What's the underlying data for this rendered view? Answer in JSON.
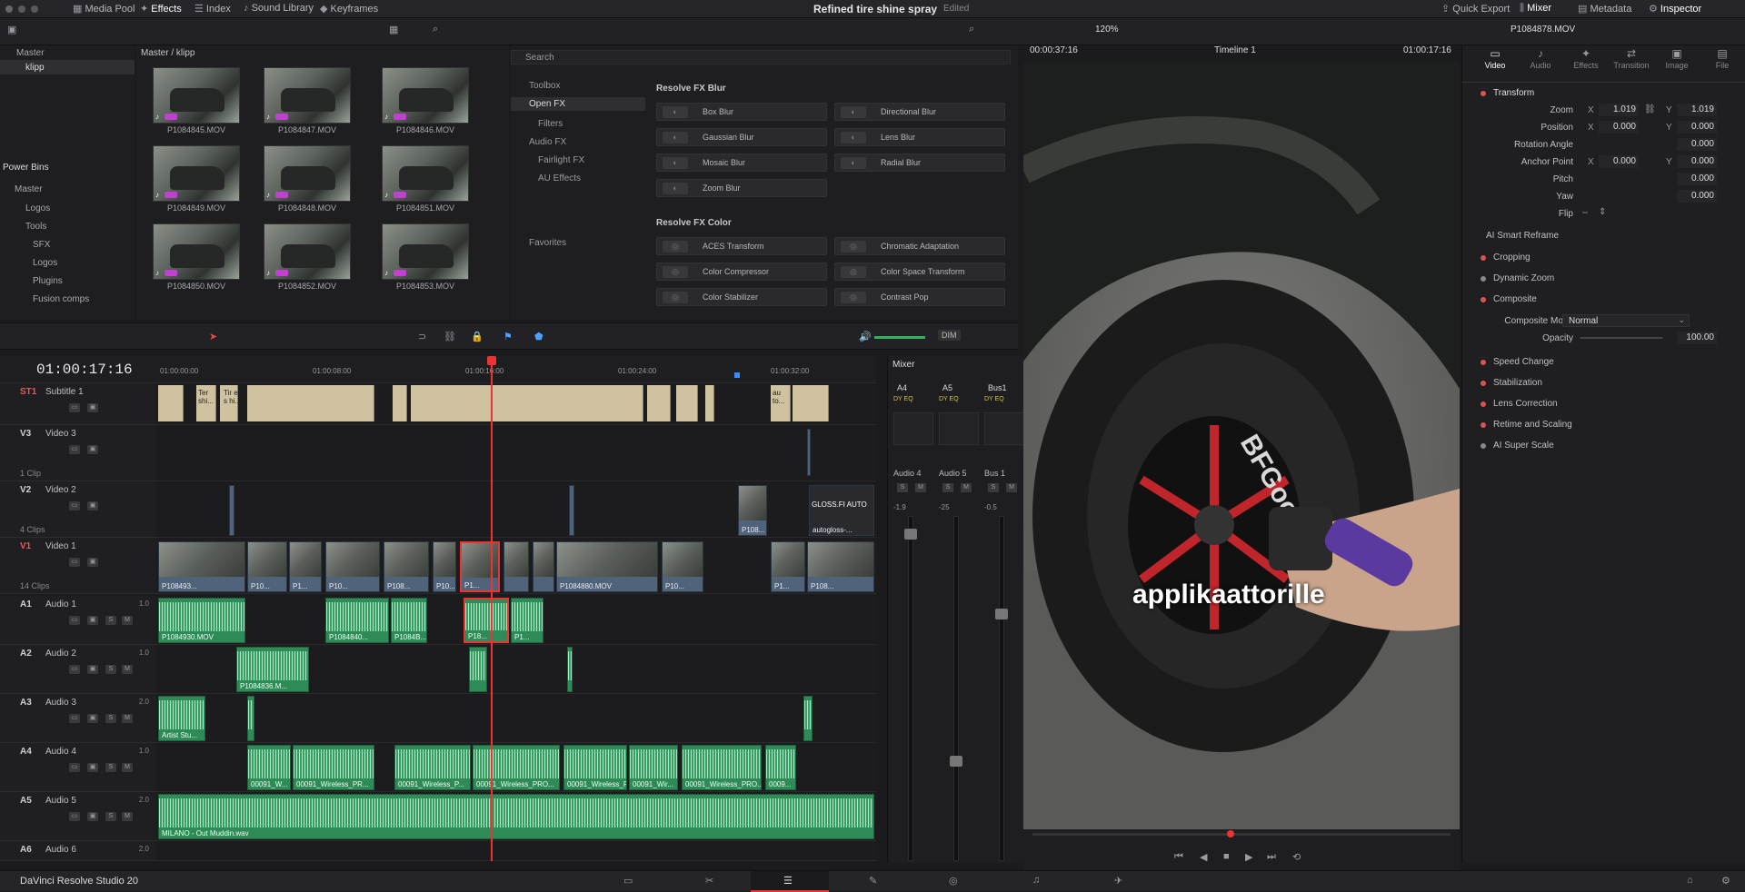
{
  "topbar": {
    "media_pool": "Media Pool",
    "effects": "Effects",
    "index": "Index",
    "sound_library": "Sound Library",
    "keyframes": "Keyframes",
    "project_title": "Refined tire shine spray",
    "edited": "Edited",
    "quick_export": "Quick Export",
    "mixer": "Mixer",
    "metadata": "Metadata",
    "inspector": "Inspector"
  },
  "viewer_bar": {
    "zoom": "120%",
    "timecode_left": "00:00:37:16",
    "timeline_name": "Timeline 1",
    "timecode_right": "01:00:17:16",
    "clip_name": "P1084878.MOV"
  },
  "bins": {
    "master": "Master",
    "klipp": "klipp",
    "path": "Master / klipp",
    "power_bins": "Power Bins",
    "pb_master": "Master",
    "logos": "Logos",
    "tools": "Tools",
    "sfx": "SFX",
    "logos2": "Logos",
    "plugins": "Plugins",
    "fusion_comps": "Fusion comps"
  },
  "clips": [
    "P1084845.MOV",
    "P1084847.MOV",
    "P1084846.MOV",
    "P1084849.MOV",
    "P1084848.MOV",
    "P1084851.MOV",
    "P1084850.MOV",
    "P1084852.MOV",
    "P1084853.MOV"
  ],
  "fx": {
    "search_placeholder": "Search",
    "toolbox": "Toolbox",
    "open_fx": "Open FX",
    "filters": "Filters",
    "audio_fx": "Audio FX",
    "fairlight_fx": "Fairlight FX",
    "au_effects": "AU Effects",
    "favorites": "Favorites",
    "blur_section": "Resolve FX Blur",
    "blur_items": [
      "Box Blur",
      "Directional Blur",
      "Gaussian Blur",
      "Lens Blur",
      "Mosaic Blur",
      "Radial Blur",
      "Zoom Blur"
    ],
    "color_section": "Resolve FX Color",
    "color_items": [
      "ACES Transform",
      "Chromatic Adaptation",
      "Color Compressor",
      "Color Space Transform",
      "Color Stabilizer",
      "Contrast Pop"
    ]
  },
  "timeline": {
    "timecode": "01:00:17:16",
    "ruler": [
      "01:00:00:00",
      "01:00:08:00",
      "01:00:16:00",
      "01:00:24:00",
      "01:00:32:00"
    ],
    "dim": "DIM",
    "tracks": {
      "st1": {
        "id": "ST1",
        "name": "Subtitle 1"
      },
      "v3": {
        "id": "V3",
        "name": "Video 3",
        "count": "1 Clip"
      },
      "v2": {
        "id": "V2",
        "name": "Video 2",
        "count": "4 Clips"
      },
      "v1": {
        "id": "V1",
        "name": "Video 1",
        "count": "14 Clips"
      },
      "a1": {
        "id": "A1",
        "name": "Audio 1",
        "vol": "1.0"
      },
      "a2": {
        "id": "A2",
        "name": "Audio 2",
        "vol": "1.0"
      },
      "a3": {
        "id": "A3",
        "name": "Audio 3",
        "vol": "2.0"
      },
      "a4": {
        "id": "A4",
        "name": "Audio 4",
        "vol": "1.0"
      },
      "a5": {
        "id": "A5",
        "name": "Audio 5",
        "vol": "2.0"
      },
      "a6": {
        "id": "A6",
        "name": "Audio 6",
        "vol": "2.0"
      }
    },
    "subtitle_texts": [
      "Ter shi...",
      "Tir e s hi...",
      "au to..."
    ],
    "v2_labels": [
      "P108...",
      "GLOSS.FI AUTO",
      "autogloss-..."
    ],
    "v1_labels": [
      "P108493...",
      "P10...",
      "P1...",
      "P10...",
      "P108...",
      "P10...",
      "P1...",
      "P1084880.MOV",
      "P10...",
      "P1...",
      "P108..."
    ],
    "a1_labels": [
      "P1084930.MOV",
      "P1084840...",
      "P1084B...",
      "P18...",
      "P1..."
    ],
    "a2_labels": [
      "P1084836.M..."
    ],
    "a3_labels": [
      "Artist Stu..."
    ],
    "a4_labels": [
      "00091_W...",
      "00091_Wireless_PR...",
      "00091_Wireless_P...",
      "00091_Wireless_PRO...",
      "00091_Wireless_PRO...",
      "00091_Wir...",
      "00091_Wireless_PRO...",
      "0009..."
    ],
    "a5_labels": [
      "MILANO - Out Muddin.wav"
    ]
  },
  "mixer": {
    "title": "Mixer",
    "channels": [
      "A4",
      "A5",
      "Bus1"
    ],
    "names": [
      "Audio 4",
      "Audio 5",
      "Bus 1"
    ],
    "levels": [
      "-1.9",
      "-25",
      "-0.5"
    ],
    "scale": [
      "0",
      "5",
      "10",
      "15",
      "20",
      "30",
      "40",
      "50"
    ]
  },
  "viewer": {
    "subtitle": "applikaattorille",
    "brand_text": "BFGoodrich"
  },
  "inspector": {
    "tabs": [
      "Video",
      "Audio",
      "Effects",
      "Transition",
      "Image",
      "File"
    ],
    "transform": "Transform",
    "zoom_label": "Zoom",
    "zoom_x": "1.019",
    "zoom_y": "1.019",
    "position_label": "Position",
    "pos_x": "0.000",
    "pos_y": "0.000",
    "rotation_label": "Rotation Angle",
    "rotation": "0.000",
    "anchor_label": "Anchor Point",
    "anchor_x": "0.000",
    "anchor_y": "0.000",
    "pitch_label": "Pitch",
    "pitch": "0.000",
    "yaw_label": "Yaw",
    "yaw": "0.000",
    "flip_label": "Flip",
    "smart_reframe": "AI Smart Reframe",
    "cropping": "Cropping",
    "dynamic_zoom": "Dynamic Zoom",
    "composite": "Composite",
    "composite_mode_label": "Composite Mode",
    "composite_mode": "Normal",
    "opacity_label": "Opacity",
    "opacity": "100.00",
    "speed_change": "Speed Change",
    "stabilization": "Stabilization",
    "lens_correction": "Lens Correction",
    "retime_scaling": "Retime and Scaling",
    "super_scale": "AI Super Scale"
  },
  "bottom": {
    "app_name": "DaVinci Resolve Studio 20"
  }
}
